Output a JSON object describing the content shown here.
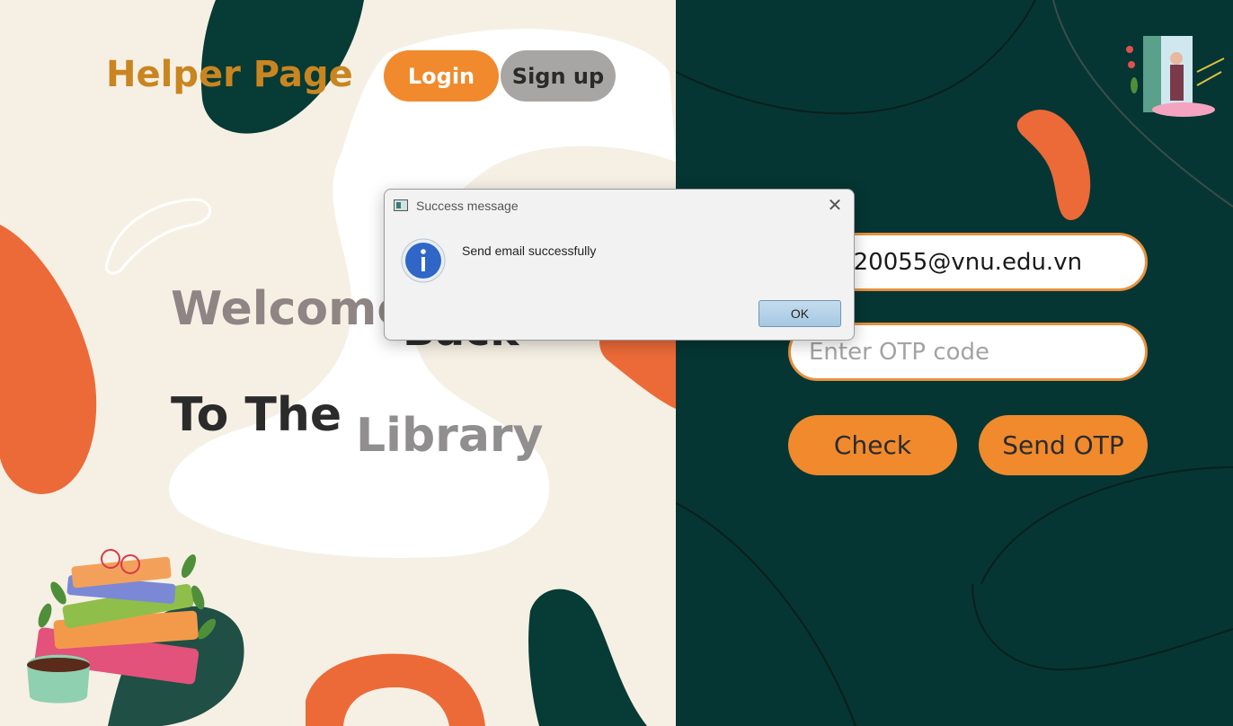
{
  "header": {
    "title": "Helper Page",
    "login_label": "Login",
    "signup_label": "Sign up"
  },
  "welcome": {
    "line1": "Welcome",
    "line1b": "Back",
    "line2": "To The",
    "line2b": "Library"
  },
  "form": {
    "email_value": "22020055@vnu.edu.vn",
    "otp_placeholder": "Enter OTP code",
    "check_label": "Check",
    "send_otp_label": "Send OTP"
  },
  "dialog": {
    "title": "Success message",
    "message": "Send email successfully",
    "ok_label": "OK",
    "close_glyph": "✕"
  },
  "colors": {
    "left_bg": "#f6f0e4",
    "right_bg": "#053633",
    "accent_orange": "#f08a2d",
    "title_gold": "#c98520"
  }
}
